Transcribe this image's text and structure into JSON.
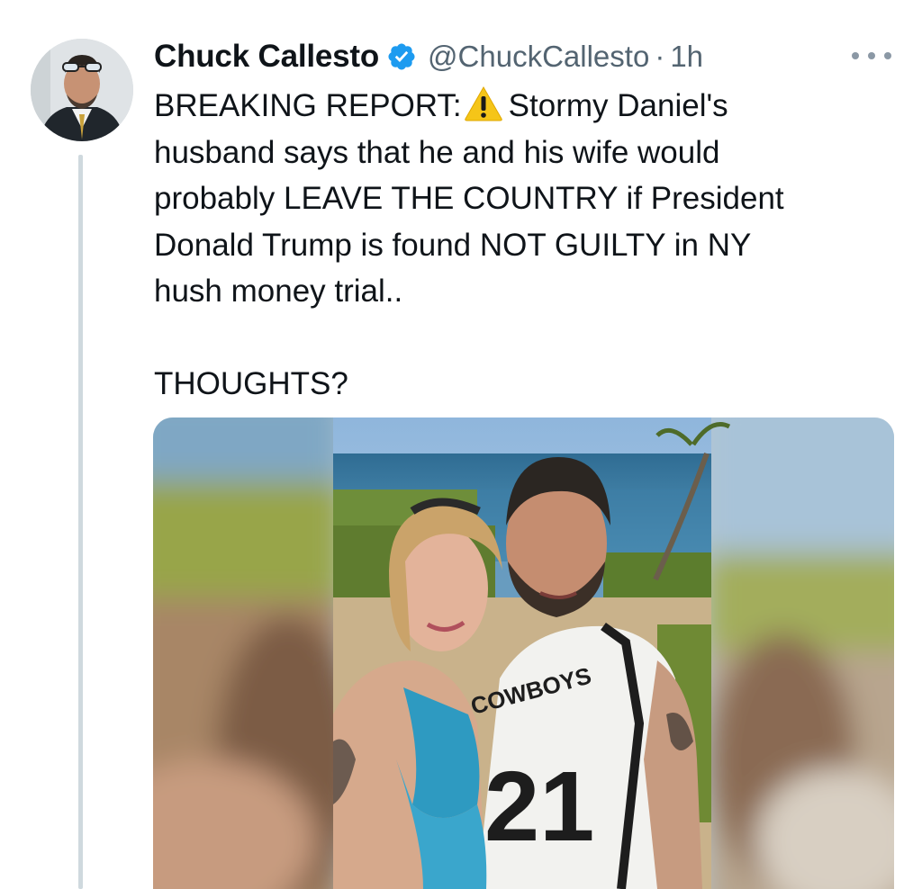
{
  "author": {
    "name": "Chuck Callesto",
    "handle": "@ChuckCallesto",
    "separator": "·",
    "time": "1h",
    "verified": true,
    "avatar_icon": "user-avatar-photo"
  },
  "tweet": {
    "lines": [
      "BREAKING REPORT:",
      "Stormy Daniel's",
      "husband says that he and his wife would",
      "probably LEAVE THE COUNTRY if President",
      "Donald Trump is found NOT GUILTY in NY",
      "hush money trial..",
      "THOUGHTS?"
    ],
    "warning_icon": "warning-sign-emoji"
  },
  "media": {
    "jersey_text": "COWBOYS",
    "jersey_number": "21"
  },
  "more_icon": "more-options-icon",
  "colors": {
    "text": "#0f1419",
    "secondary": "#536471",
    "verified": "#1d9bf0",
    "thread_line": "#cfd9de"
  }
}
